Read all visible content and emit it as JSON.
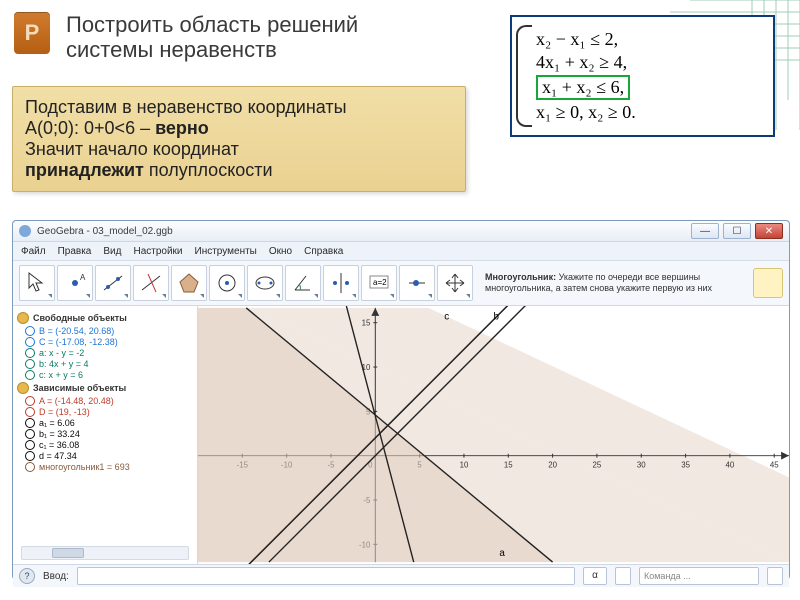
{
  "slide": {
    "badge": "P",
    "title_l1": "Построить область решений",
    "title_l2": "системы неравенств"
  },
  "system": {
    "r1": "x₂ − x₁ ≤ 2,",
    "r2": "4x₁ + x₂ ≥ 4,",
    "r3": "x₁ + x₂ ≤ 6,",
    "r4": "x₁ ≥ 0, x₂ ≥ 0."
  },
  "callout": {
    "l1a": "Подставим в неравенство координаты",
    "l2a": "A(0;0): 0+0<6 – ",
    "l2b": "верно",
    "l3a": "Значит начало координат",
    "l4a": "принадлежит",
    "l4b": " полуплоскости"
  },
  "ggb": {
    "title": "GeoGebra - 03_model_02.ggb",
    "menu": [
      "Файл",
      "Правка",
      "Вид",
      "Настройки",
      "Инструменты",
      "Окно",
      "Справка"
    ],
    "toolhint_title": "Многоугольник: ",
    "toolhint_text": "Укажите по очереди все вершины многоугольника, а затем снова укажите первую из них",
    "algebra": {
      "free": "Свободные объекты",
      "dep": "Зависимые объекты",
      "items_free": [
        {
          "color": "#1e74d6",
          "label": "B = (-20.54, 20.68)"
        },
        {
          "color": "#1e74d6",
          "label": "C = (-17.08, -12.38)"
        },
        {
          "color": "#0a7b63",
          "label": "a: x - y = -2"
        },
        {
          "color": "#0a7b63",
          "label": "b: 4x + y = 4"
        },
        {
          "color": "#0a7b63",
          "label": "c: x + y = 6"
        }
      ],
      "items_dep": [
        {
          "color": "#c03a2a",
          "label": "A = (-14.48, 20.48)"
        },
        {
          "color": "#c03a2a",
          "label": "D = (19, -13)"
        },
        {
          "color": "#0a0a0a",
          "label": "a₁ = 6.06"
        },
        {
          "color": "#0a0a0a",
          "label": "b₁ = 33.24"
        },
        {
          "color": "#0a0a0a",
          "label": "c₁ = 36.08"
        },
        {
          "color": "#0a0a0a",
          "label": "d = 47.34"
        },
        {
          "color": "#8a5a3a",
          "label": "многоугольник1 = 693"
        }
      ]
    },
    "input_label": "Ввод:",
    "command_ph": "Команда ...",
    "alpha": "α"
  },
  "chart_data": {
    "type": "line",
    "title": "",
    "xlabel": "",
    "ylabel": "",
    "xlim": [
      -20,
      45
    ],
    "ylim": [
      -15,
      20
    ],
    "grid": false,
    "series": [
      {
        "name": "a: y = x + 2",
        "x": [
          -20,
          20
        ],
        "y": [
          -18,
          22
        ]
      },
      {
        "name": "b: y = 4 − 4x",
        "x": [
          -4,
          6
        ],
        "y": [
          20,
          -20
        ]
      },
      {
        "name": "c: y = 6 − x",
        "x": [
          -14,
          26
        ],
        "y": [
          20,
          -20
        ]
      }
    ],
    "annotations": [
      "a",
      "b",
      "c"
    ],
    "shaded_region": "below line c (x+y≤6)"
  }
}
